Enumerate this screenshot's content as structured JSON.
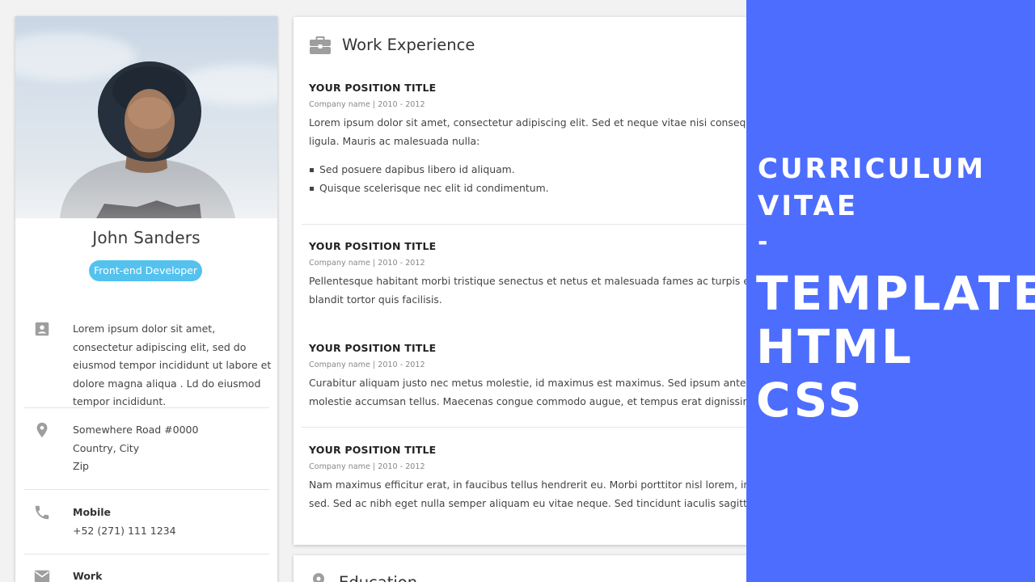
{
  "profile": {
    "name": "John Sanders",
    "role": "Front-end Developer",
    "about": "Lorem ipsum dolor sit amet, consectetur adipiscing elit, sed do eiusmod tempor incididunt ut labore et dolore magna aliqua . Ld do eiusmod tempor incididunt.",
    "address": [
      "Somewhere Road #0000",
      "Country, City",
      "Zip"
    ],
    "mobile_label": "Mobile",
    "mobile": "+52 (271) 111 1234",
    "work_label": "Work"
  },
  "work": {
    "title": "Work Experience",
    "jobs": [
      {
        "position": "YOUR POSITION TITLE",
        "company": "Company name | 2010 - 2012",
        "lines": [
          "Lorem ipsum dolor sit amet, consectetur adipiscing elit. Sed et neque vitae nisi consequat blandit",
          "ligula. Mauris ac malesuada nulla:"
        ],
        "bullets": [
          "Sed posuere dapibus libero id aliquam.",
          "Quisque scelerisque nec elit id condimentum."
        ]
      },
      {
        "position": "YOUR POSITION TITLE",
        "company": "Company name | 2010 - 2012",
        "lines": [
          "Pellentesque habitant morbi tristique senectus et netus et malesuada fames ac turpis egestas. C",
          "blandit tortor quis facilisis."
        ]
      },
      {
        "position": "YOUR POSITION TITLE",
        "company": "Company name | 2010 - 2012",
        "lines": [
          "Curabitur aliquam justo nec metus molestie, id maximus est maximus. Sed ipsum ante, mollis ac",
          "molestie accumsan tellus. Maecenas congue commodo augue, et tempus erat dignissim eget."
        ]
      },
      {
        "position": "YOUR POSITION TITLE",
        "company": "Company name | 2010 - 2012",
        "lines": [
          "Nam maximus efficitur erat, in faucibus tellus hendrerit eu. Morbi porttitor nisl lorem, in pharetr",
          "sed. Sed ac nibh eget nulla semper aliquam eu vitae neque. Sed tincidunt iaculis sagittis. Pellent"
        ]
      }
    ]
  },
  "education": {
    "title": "Education"
  },
  "banner": {
    "line1": "CURRICULUM",
    "line2": "VITAE",
    "dash": "-",
    "line3": "TEMPLATE",
    "line4": "HTML",
    "line5": "CSS"
  },
  "colors": {
    "accent_blue": "#4d6dff",
    "badge": "#53c2ee",
    "icon_gray": "#9e9e9e"
  }
}
